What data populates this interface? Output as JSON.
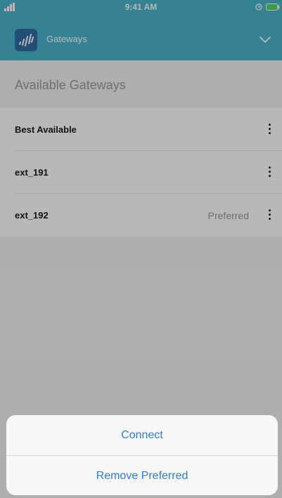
{
  "status_bar": {
    "time": "9:41 AM"
  },
  "header": {
    "title": "Gateways",
    "logo_icon": "signal-bars-logo",
    "menu_icon": "chevron-down-icon"
  },
  "section": {
    "title": "Available Gateways"
  },
  "gateways": [
    {
      "name": "Best Available",
      "tag": ""
    },
    {
      "name": "ext_191",
      "tag": ""
    },
    {
      "name": "ext_192",
      "tag": "Preferred"
    }
  ],
  "action_sheet": {
    "connect_label": "Connect",
    "remove_preferred_label": "Remove Preferred"
  },
  "colors": {
    "header_background": "#4ab4cc",
    "logo_background": "#2e6ba6",
    "action_text": "#2f7bd6",
    "battery": "#4cd964"
  }
}
